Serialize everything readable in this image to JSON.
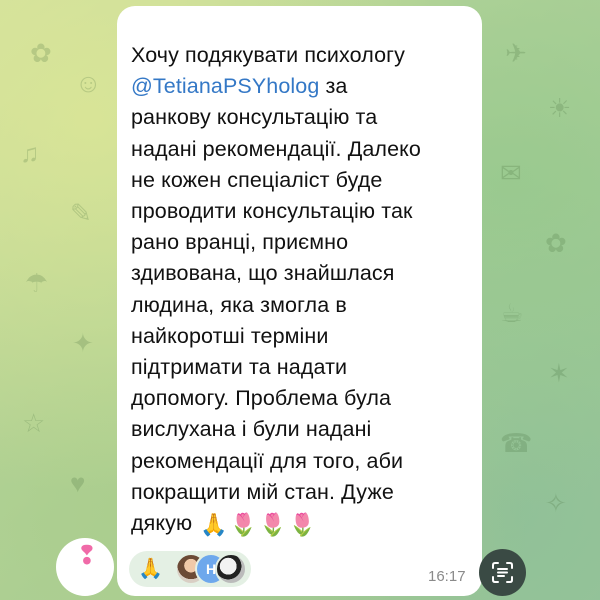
{
  "message": {
    "line_1": "Хочу подякувати психологу",
    "mention": "@TetianaPSYholog",
    "line_2_rest": " за",
    "line_3": "ранкову консультацію та",
    "line_4": "надані рекомендації. Далеко",
    "line_5": "не кожен спеціаліст буде",
    "line_6": "проводити консультацію так",
    "line_7": "рано вранці, приємно",
    "line_8": "здивована, що знайшлася",
    "line_9": "людина, яка змогла в",
    "line_10": "найкоротші терміни",
    "line_11": "підтримати та надати",
    "line_12": "допомогу. Проблема була",
    "line_13": "вислухана і були надані",
    "line_14": "рекомендації для того, аби",
    "line_15": "покращити мій стан. Дуже",
    "line_16": "дякую",
    "emojis": [
      "🙏",
      "🌷",
      "🌷",
      "🌷"
    ]
  },
  "reaction": {
    "emoji": "🙏",
    "avatar_2_letter": "Н"
  },
  "timestamp": "16:17",
  "colors": {
    "mention": "#3478c6",
    "bubble": "#ffffff",
    "text": "#111111",
    "timestamp": "#8a8a8a"
  },
  "icons": {
    "scan_button": "text-scan-icon"
  }
}
